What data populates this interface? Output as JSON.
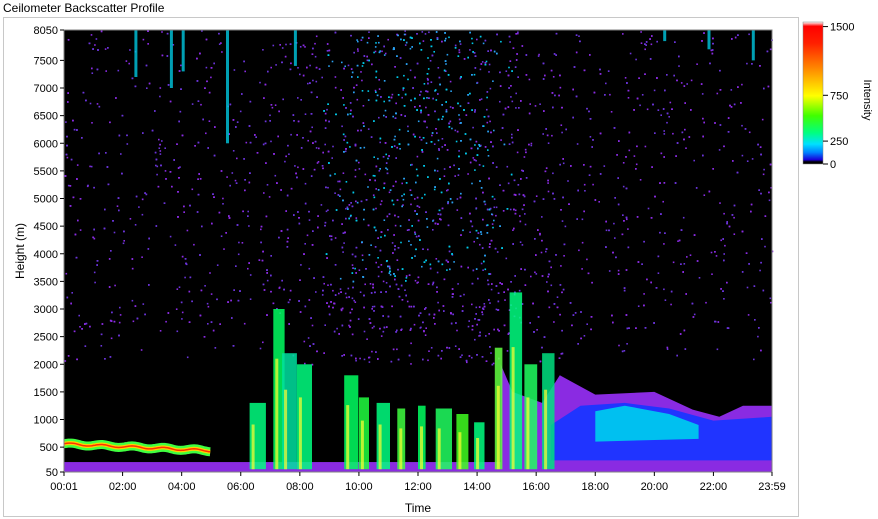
{
  "window": {
    "title": "Ceilometer Backscatter Profile"
  },
  "chart_data": {
    "type": "heatmap",
    "title": "",
    "xlabel": "Time",
    "ylabel": "Height (m)",
    "x_ticks": [
      "00:01",
      "02:00",
      "04:00",
      "06:00",
      "08:00",
      "10:00",
      "12:00",
      "14:00",
      "16:00",
      "18:00",
      "20:00",
      "22:00",
      "23:59"
    ],
    "x_tick_hours": [
      0.0167,
      2,
      4,
      6,
      8,
      10,
      12,
      14,
      16,
      18,
      20,
      22,
      23.983
    ],
    "xlim_hours": [
      0.0167,
      23.983
    ],
    "y_ticks": [
      50,
      500,
      1000,
      1500,
      2000,
      2500,
      3000,
      3500,
      4000,
      4500,
      5000,
      5500,
      6000,
      6500,
      7000,
      7500,
      8050
    ],
    "ylim": [
      50,
      8050
    ],
    "colorbar": {
      "label": "Intensity",
      "ticks": [
        0,
        250,
        750,
        1500
      ],
      "range": [
        0,
        1550
      ]
    },
    "colors": {
      "background": "#000000",
      "noise": "#8a2be2",
      "low": "#7a1fe8",
      "mid_low": "#1e2cff",
      "mid": "#00d8ff",
      "mid_high": "#00ff66",
      "high": "#ffff00",
      "max": "#ff2000"
    }
  }
}
